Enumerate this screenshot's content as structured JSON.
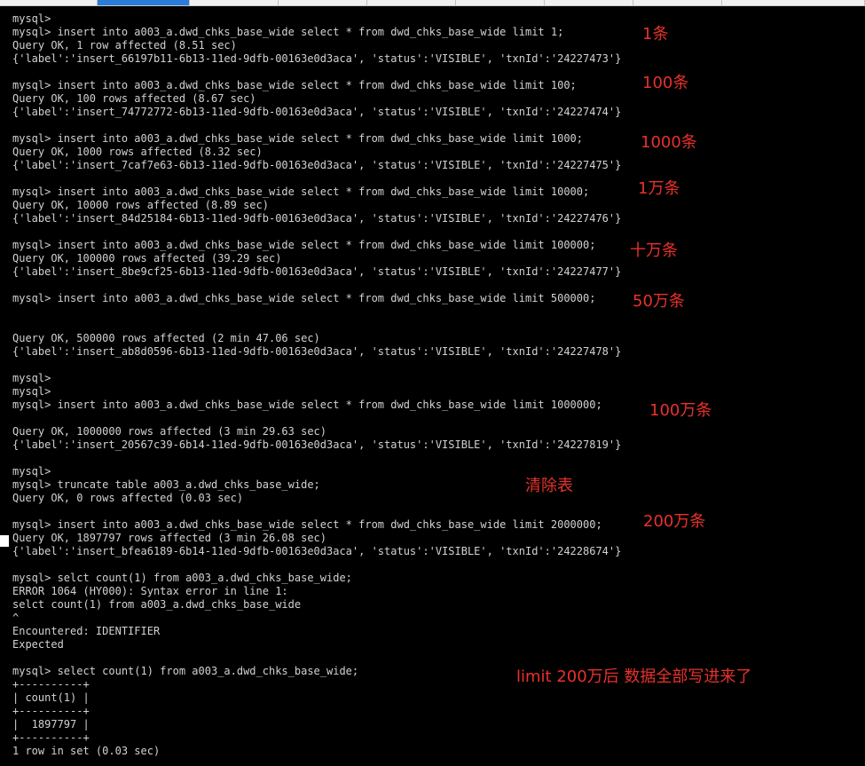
{
  "terminal_lines": [
    "mysql>",
    "mysql> insert into a003_a.dwd_chks_base_wide select * from dwd_chks_base_wide limit 1;",
    "Query OK, 1 row affected (8.51 sec)",
    "{'label':'insert_66197b11-6b13-11ed-9dfb-00163e0d3aca', 'status':'VISIBLE', 'txnId':'24227473'}",
    "",
    "mysql> insert into a003_a.dwd_chks_base_wide select * from dwd_chks_base_wide limit 100;",
    "Query OK, 100 rows affected (8.67 sec)",
    "{'label':'insert_74772772-6b13-11ed-9dfb-00163e0d3aca', 'status':'VISIBLE', 'txnId':'24227474'}",
    "",
    "mysql> insert into a003_a.dwd_chks_base_wide select * from dwd_chks_base_wide limit 1000;",
    "Query OK, 1000 rows affected (8.32 sec)",
    "{'label':'insert_7caf7e63-6b13-11ed-9dfb-00163e0d3aca', 'status':'VISIBLE', 'txnId':'24227475'}",
    "",
    "mysql> insert into a003_a.dwd_chks_base_wide select * from dwd_chks_base_wide limit 10000;",
    "Query OK, 10000 rows affected (8.89 sec)",
    "{'label':'insert_84d25184-6b13-11ed-9dfb-00163e0d3aca', 'status':'VISIBLE', 'txnId':'24227476'}",
    "",
    "mysql> insert into a003_a.dwd_chks_base_wide select * from dwd_chks_base_wide limit 100000;",
    "Query OK, 100000 rows affected (39.29 sec)",
    "{'label':'insert_8be9cf25-6b13-11ed-9dfb-00163e0d3aca', 'status':'VISIBLE', 'txnId':'24227477'}",
    "",
    "mysql> insert into a003_a.dwd_chks_base_wide select * from dwd_chks_base_wide limit 500000;",
    "",
    "",
    "Query OK, 500000 rows affected (2 min 47.06 sec)",
    "{'label':'insert_ab8d0596-6b13-11ed-9dfb-00163e0d3aca', 'status':'VISIBLE', 'txnId':'24227478'}",
    "",
    "mysql>",
    "mysql>",
    "mysql> insert into a003_a.dwd_chks_base_wide select * from dwd_chks_base_wide limit 1000000;",
    "",
    "Query OK, 1000000 rows affected (3 min 29.63 sec)",
    "{'label':'insert_20567c39-6b14-11ed-9dfb-00163e0d3aca', 'status':'VISIBLE', 'txnId':'24227819'}",
    "",
    "mysql>",
    "mysql> truncate table a003_a.dwd_chks_base_wide;",
    "Query OK, 0 rows affected (0.03 sec)",
    "",
    "mysql> insert into a003_a.dwd_chks_base_wide select * from dwd_chks_base_wide limit 2000000;",
    "Query OK, 1897797 rows affected (3 min 26.08 sec)",
    "{'label':'insert_bfea6189-6b14-11ed-9dfb-00163e0d3aca', 'status':'VISIBLE', 'txnId':'24228674'}",
    "",
    "mysql> selct count(1) from a003_a.dwd_chks_base_wide;",
    "ERROR 1064 (HY000): Syntax error in line 1:",
    "selct count(1) from a003_a.dwd_chks_base_wide",
    "^",
    "Encountered: IDENTIFIER",
    "Expected",
    "",
    "mysql> select count(1) from a003_a.dwd_chks_base_wide;",
    "+----------+",
    "| count(1) |",
    "+----------+",
    "|  1897797 |",
    "+----------+",
    "1 row in set (0.03 sec)"
  ],
  "annotations": [
    "1条",
    "100条",
    "1000条",
    "1万条",
    "十万条",
    "50万条",
    "100万条",
    "清除表",
    "200万条",
    "limit 200万后 数据全部写进来了"
  ],
  "colors": {
    "background": "#000000",
    "text": "#d2d2d2",
    "annotation": "#e8312c"
  }
}
